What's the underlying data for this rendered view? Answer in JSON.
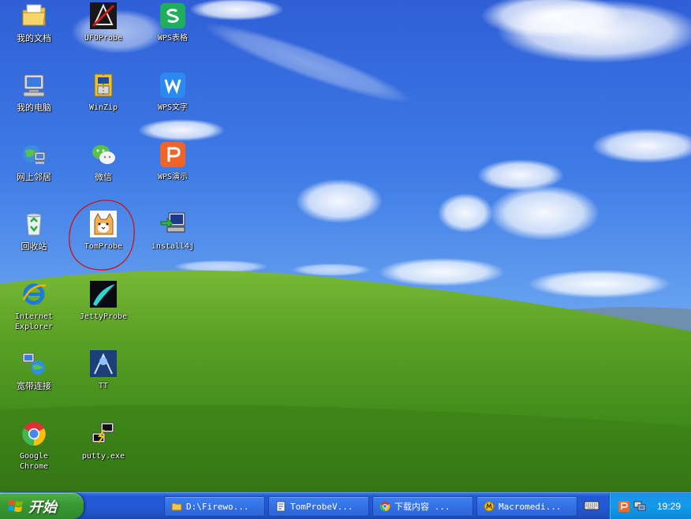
{
  "desktop": {
    "icons": [
      {
        "label": "我的文档",
        "icon": "my-documents-icon"
      },
      {
        "label": "UFOProbe",
        "icon": "ufoprobe-icon"
      },
      {
        "label": "WPS表格",
        "icon": "wps-spreadsheet-icon"
      },
      {
        "label": "我的电脑",
        "icon": "my-computer-icon"
      },
      {
        "label": "WinZip",
        "icon": "winzip-icon"
      },
      {
        "label": "WPS文字",
        "icon": "wps-writer-icon"
      },
      {
        "label": "网上邻居",
        "icon": "network-places-icon"
      },
      {
        "label": "微信",
        "icon": "wechat-icon"
      },
      {
        "label": "WPS演示",
        "icon": "wps-presentation-icon"
      },
      {
        "label": "回收站",
        "icon": "recycle-bin-icon"
      },
      {
        "label": "TomProbe",
        "icon": "tomprobe-cat-icon"
      },
      {
        "label": "install4j",
        "icon": "install4j-icon"
      },
      {
        "label": "Internet\nExplorer",
        "icon": "internet-explorer-icon"
      },
      {
        "label": "JettyProbe",
        "icon": "jettyprobe-icon"
      },
      {
        "label": "宽带连接",
        "icon": "broadband-connection-icon"
      },
      {
        "label": "TT",
        "icon": "tt-icon"
      },
      {
        "label": "Google\nChrome",
        "icon": "google-chrome-icon"
      },
      {
        "label": "putty.exe",
        "icon": "putty-icon"
      }
    ]
  },
  "taskbar": {
    "start_label": "开始",
    "tasks": [
      {
        "label": "D:\\Firewo...",
        "icon": "folder-icon"
      },
      {
        "label": "TomProbeV...",
        "icon": "document-icon"
      },
      {
        "label": "下载内容 ...",
        "icon": "chrome-icon"
      },
      {
        "label": "Macromedi...",
        "icon": "macromedia-icon"
      }
    ],
    "clock": "19:29"
  },
  "colors": {
    "taskbar_blue": "#245ad6",
    "start_green": "#3a9a35",
    "tray_blue": "#139bea",
    "highlight_circle": "#d01010"
  }
}
